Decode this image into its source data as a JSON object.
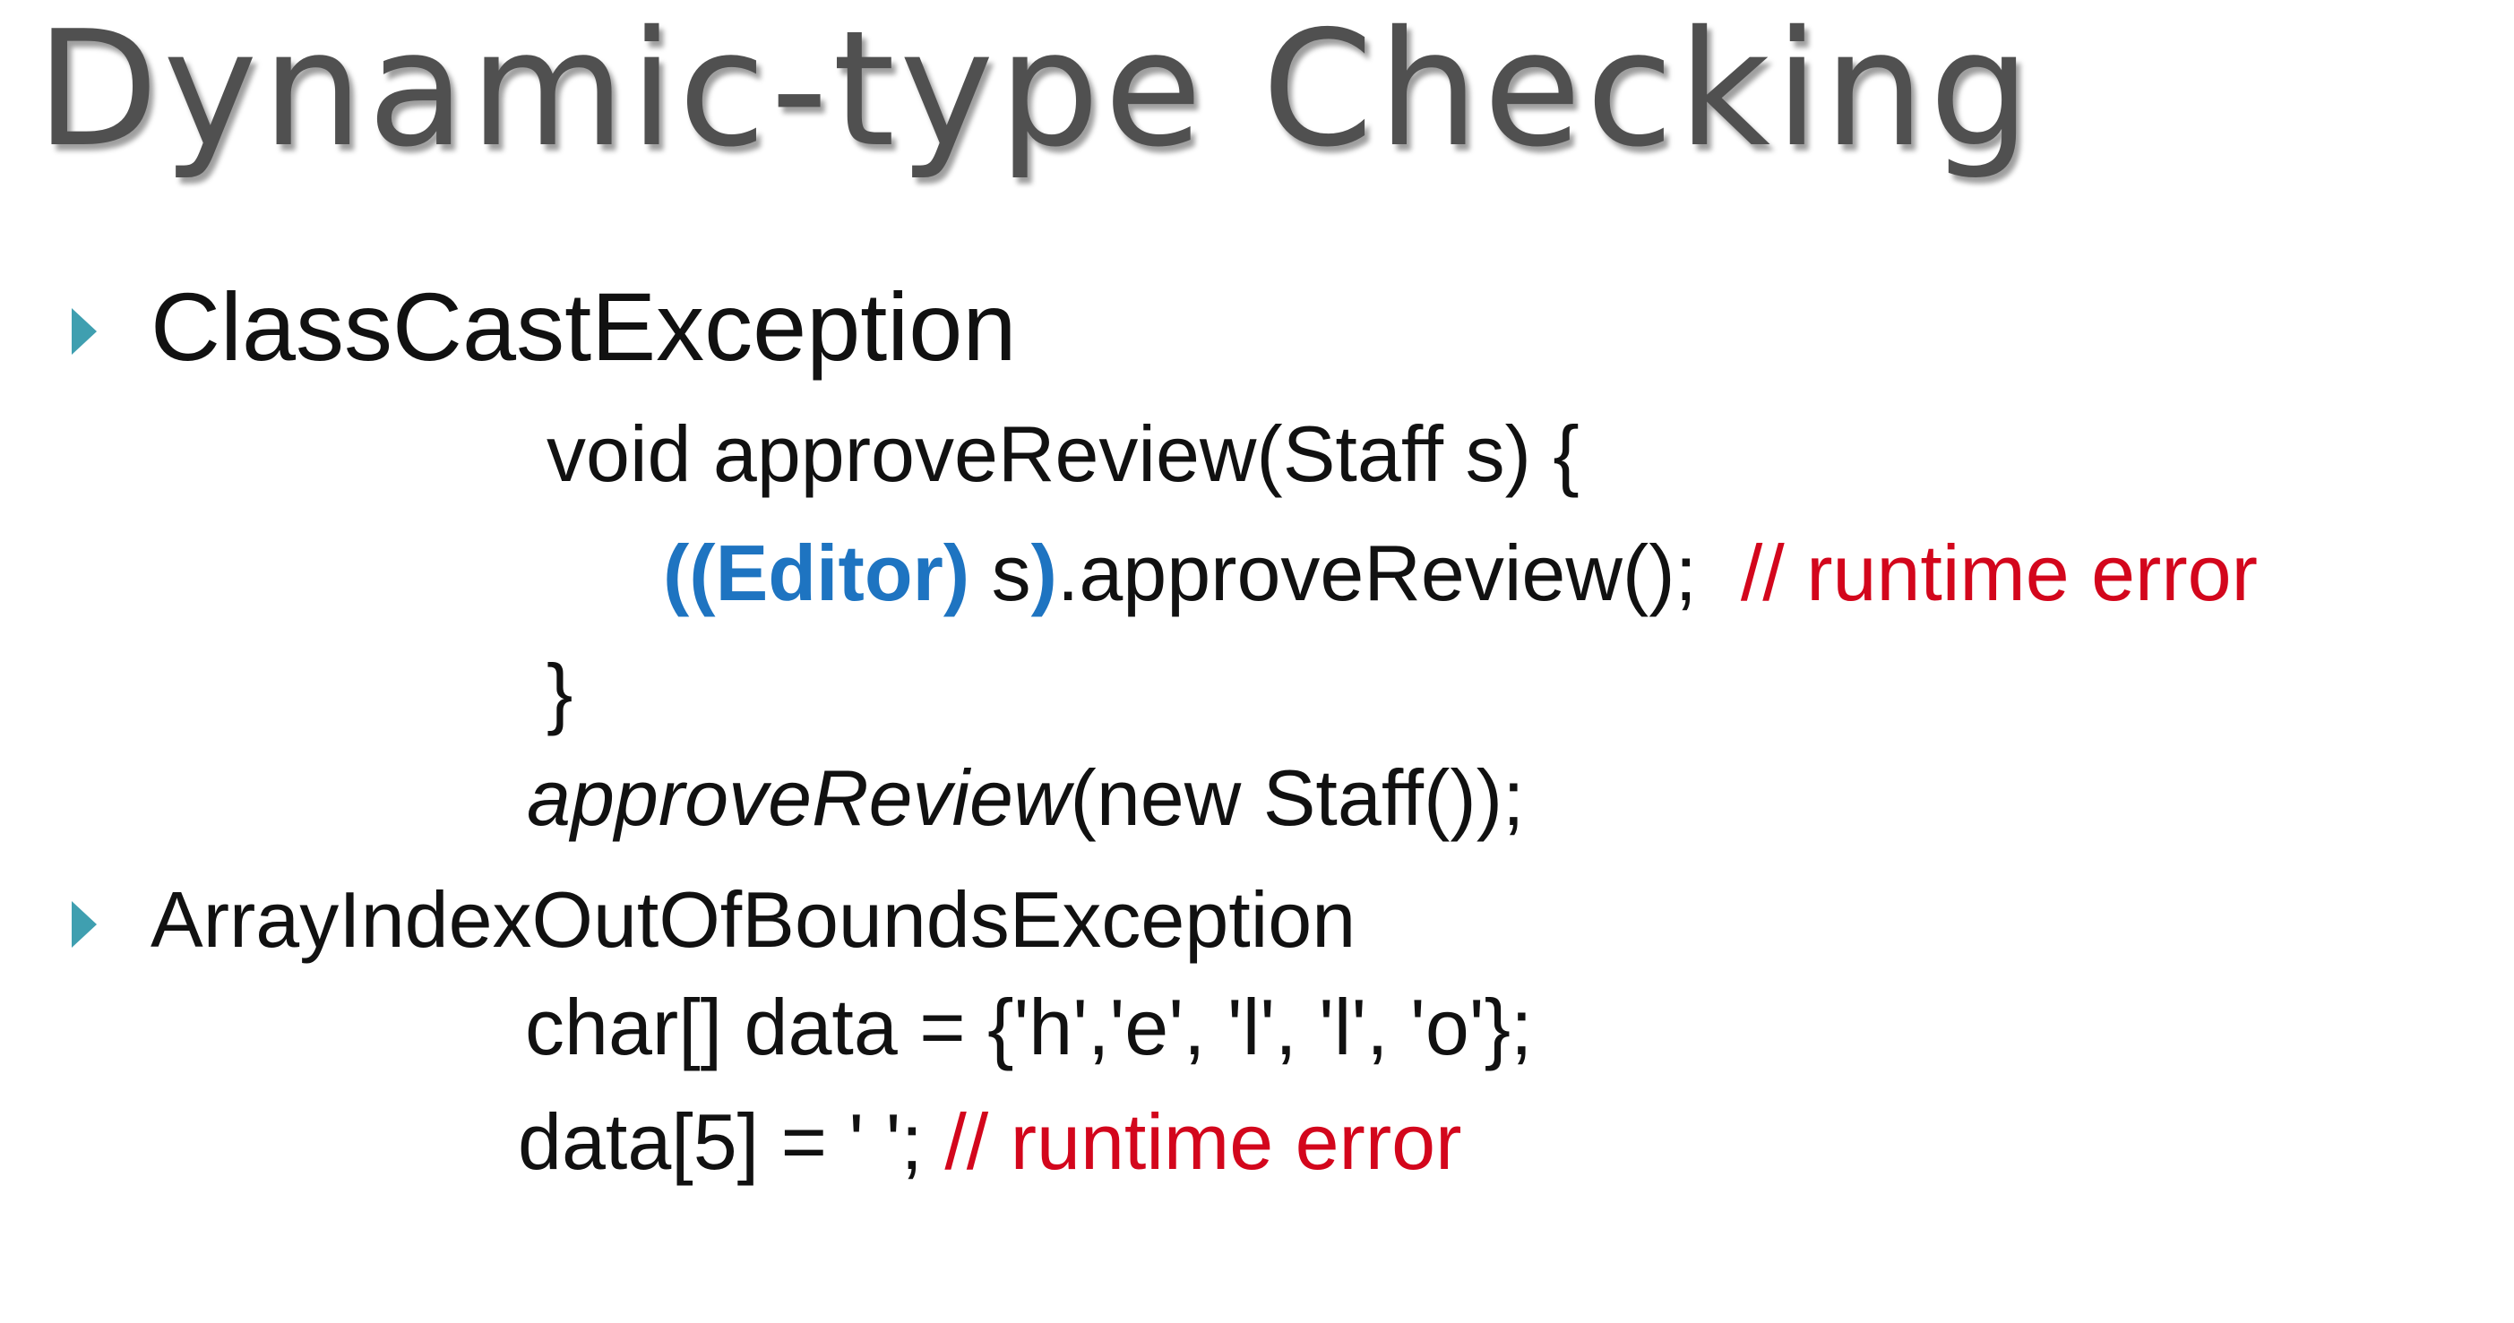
{
  "title": "Dynamic-type Checking",
  "colors": {
    "title": "#505050",
    "bullet": "#3f9fb0",
    "keyword_blue": "#1e74c1",
    "comment_red": "#d3061c",
    "text": "#111111"
  },
  "sections": [
    {
      "heading": "ClassCastException",
      "code": {
        "line1": "void approveReview(Staff  s) {",
        "line2": {
          "cast": "((Editor)",
          "var": " s",
          "close": ")",
          "call": ".approveReview();",
          "comment": "// runtime error"
        },
        "line3": "}",
        "line4": {
          "method": "approveReview",
          "args": "(new  Staff());"
        }
      }
    },
    {
      "heading": "ArrayIndexOutOfBoundsException",
      "code": {
        "line1": "char[] data = {'h','e', 'l', 'l', 'o'};",
        "line2": {
          "stmt": "data[5] = ' ';",
          "comment": "// runtime error"
        }
      }
    }
  ]
}
